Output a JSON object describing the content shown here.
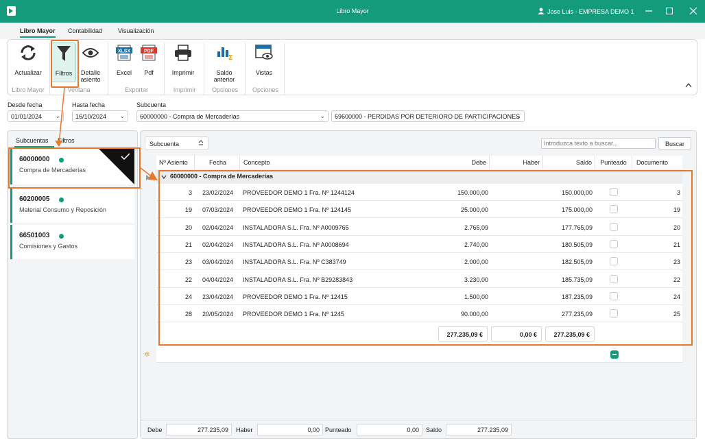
{
  "titlebar": {
    "title": "Libro Mayor",
    "user": "Jose Luis - EMPRESA DEMO 1"
  },
  "menu_tabs": [
    "Libro Mayor",
    "Contabilidad",
    "Visualización"
  ],
  "ribbon": {
    "buttons": {
      "actualizar": "Actualizar",
      "filtros": "Filtros",
      "detalle_1": "Detalle",
      "detalle_2": "asiento",
      "excel": "Excel",
      "pdf": "Pdf",
      "imprimir": "Imprimir",
      "saldo_1": "Saldo",
      "saldo_2": "anterior",
      "vistas": "Vistas"
    },
    "groups": {
      "libro_mayor": "Libro Mayor",
      "ventana": "Ventana",
      "exportar": "Exportar",
      "imprimir": "Imprimir",
      "opciones1": "Opciones",
      "opciones2": "Opciones"
    }
  },
  "filters": {
    "desde_label": "Desde fecha",
    "desde_value": "01/01/2024",
    "hasta_label": "Hasta fecha",
    "hasta_value": "16/10/2024",
    "subcuenta_label": "Subcuenta",
    "subcuenta_from": "60000000 - Compra de Mercaderías",
    "subcuenta_to": "69600000 - PERDIDAS POR DETERIORO DE PARTICIPACIONES"
  },
  "left_panel": {
    "tabs": [
      "Subcuentas",
      "Filtros"
    ],
    "accounts": [
      {
        "code": "60000000",
        "desc": "Compra de Mercaderías"
      },
      {
        "code": "60200005",
        "desc": "Material Consumo y Reposición"
      },
      {
        "code": "66501003",
        "desc": "Comisiones y Gastos"
      }
    ]
  },
  "main": {
    "group_by": "Subcuenta",
    "search_placeholder": "Introduzca texto a buscar...",
    "search_button": "Buscar",
    "columns": [
      "Nº Asiento",
      "Fecha",
      "Concepto",
      "Debe",
      "Haber",
      "Saldo",
      "Punteado",
      "Documento"
    ],
    "group_row": "60000000 - Compra de Mercaderías",
    "rows": [
      {
        "asiento": "3",
        "fecha": "23/02/2024",
        "concepto": "PROVEEDOR DEMO 1 Fra. Nº 1244124",
        "debe": "150.000,00",
        "haber": "",
        "saldo": "150.000,00",
        "documento": "3"
      },
      {
        "asiento": "19",
        "fecha": "07/03/2024",
        "concepto": "PROVEEDOR DEMO 1 Fra. Nº 124145",
        "debe": "25.000,00",
        "haber": "",
        "saldo": "175.000,00",
        "documento": "19"
      },
      {
        "asiento": "20",
        "fecha": "02/04/2024",
        "concepto": "INSTALADORA S.L. Fra. Nº A0009765",
        "debe": "2.765,09",
        "haber": "",
        "saldo": "177.765,09",
        "documento": "20"
      },
      {
        "asiento": "21",
        "fecha": "02/04/2024",
        "concepto": "INSTALADORA S.L. Fra. Nº A0008694",
        "debe": "2.740,00",
        "haber": "",
        "saldo": "180.505,09",
        "documento": "21"
      },
      {
        "asiento": "23",
        "fecha": "03/04/2024",
        "concepto": "INSTALADORA S.L. Fra. Nº C383749",
        "debe": "2.000,00",
        "haber": "",
        "saldo": "182.505,09",
        "documento": "23"
      },
      {
        "asiento": "22",
        "fecha": "04/04/2024",
        "concepto": "INSTALADORA S.L. Fra. Nº B29283843",
        "debe": "3.230,00",
        "haber": "",
        "saldo": "185.735,09",
        "documento": "22"
      },
      {
        "asiento": "24",
        "fecha": "23/04/2024",
        "concepto": "PROVEEDOR DEMO 1 Fra. Nº 12415",
        "debe": "1.500,00",
        "haber": "",
        "saldo": "187.235,09",
        "documento": "24"
      },
      {
        "asiento": "28",
        "fecha": "20/05/2024",
        "concepto": "PROVEEDOR DEMO 1 Fra. Nº 1245",
        "debe": "90.000,00",
        "haber": "",
        "saldo": "277.235,09",
        "documento": "25"
      }
    ],
    "totals": {
      "debe": "277.235,09 €",
      "haber": "0,00 €",
      "saldo": "277.235,09 €"
    }
  },
  "bottom": {
    "debe_label": "Debe",
    "debe_value": "277.235,09",
    "haber_label": "Haber",
    "haber_value": "0,00",
    "punteado_label": "Punteado",
    "punteado_value": "0,00",
    "saldo_label": "Saldo",
    "saldo_value": "277.235,09"
  },
  "colors": {
    "accent": "#139b7b",
    "highlight": "#e8772a"
  }
}
